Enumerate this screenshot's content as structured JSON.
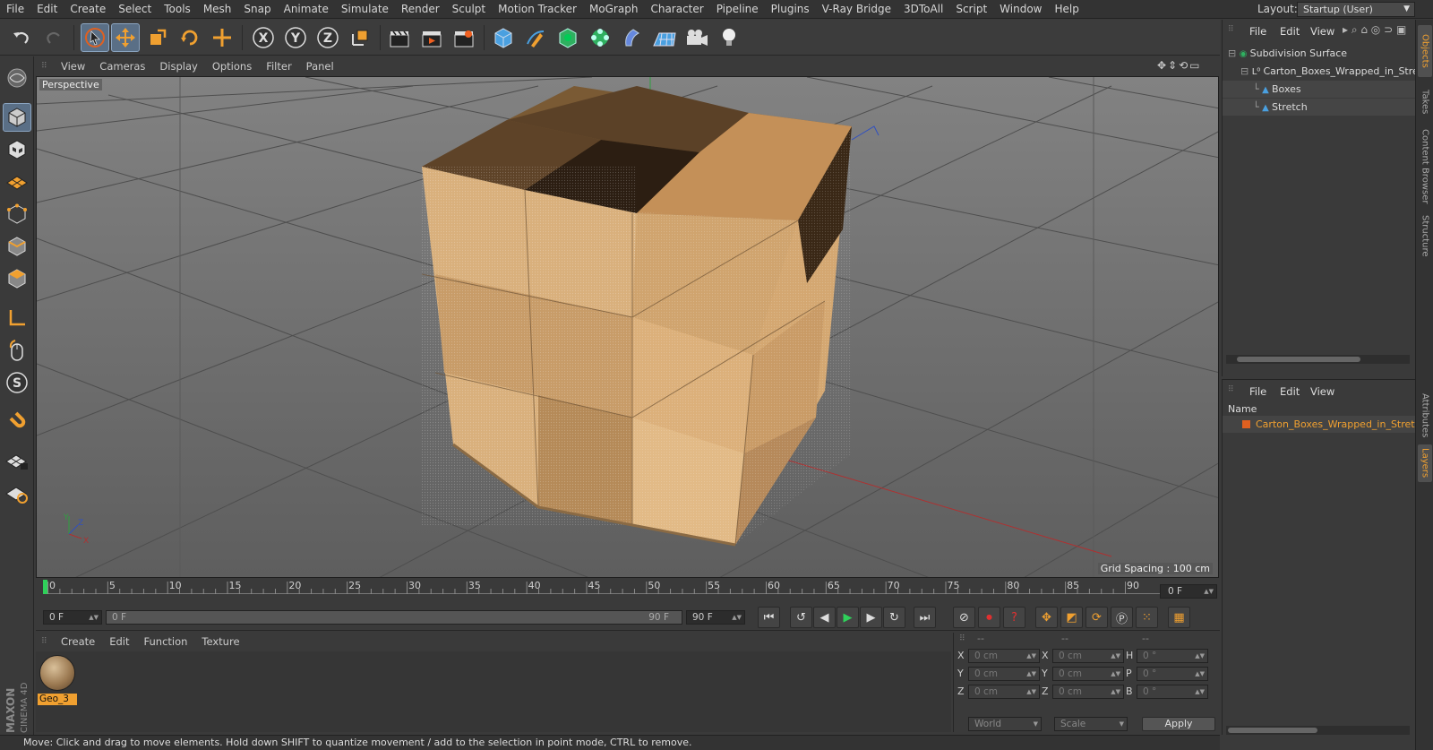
{
  "menubar": {
    "items": [
      "File",
      "Edit",
      "Create",
      "Select",
      "Tools",
      "Mesh",
      "Snap",
      "Animate",
      "Simulate",
      "Render",
      "Sculpt",
      "Motion Tracker",
      "MoGraph",
      "Character",
      "Pipeline",
      "Plugins",
      "V-Ray Bridge",
      "3DToAll",
      "Script",
      "Window",
      "Help"
    ],
    "layout_label": "Layout:",
    "layout_value": "Startup (User)"
  },
  "viewport": {
    "menus": [
      "View",
      "Cameras",
      "Display",
      "Options",
      "Filter",
      "Panel"
    ],
    "camera_label": "Perspective",
    "grid_spacing": "Grid Spacing : 100 cm",
    "axis_x": "X",
    "axis_y": "Y",
    "axis_z": "Z"
  },
  "timeline": {
    "ticks": [
      "0",
      "5",
      "10",
      "15",
      "20",
      "25",
      "30",
      "35",
      "40",
      "45",
      "50",
      "55",
      "60",
      "65",
      "70",
      "75",
      "80",
      "85",
      "90"
    ],
    "current_frame": "0 F"
  },
  "transport": {
    "start_field": "0 F",
    "range_start": "0 F",
    "range_end": "90 F",
    "end_field": "90 F"
  },
  "material_manager": {
    "menus": [
      "Create",
      "Edit",
      "Function",
      "Texture"
    ],
    "material_name": "Geo_3"
  },
  "coordinates": {
    "headers": [
      "--",
      "--",
      "--"
    ],
    "rows": [
      {
        "a": "X",
        "av": "0 cm",
        "b": "X",
        "bv": "0 cm",
        "c": "H",
        "cv": "0 °"
      },
      {
        "a": "Y",
        "av": "0 cm",
        "b": "Y",
        "bv": "0 cm",
        "c": "P",
        "cv": "0 °"
      },
      {
        "a": "Z",
        "av": "0 cm",
        "b": "Z",
        "bv": "0 cm",
        "c": "B",
        "cv": "0 °"
      }
    ],
    "mode_world": "World",
    "mode_scale": "Scale",
    "apply": "Apply"
  },
  "objects_panel": {
    "menus": [
      "File",
      "Edit",
      "View"
    ],
    "items": [
      {
        "label": "Subdivision Surface",
        "indent": 0
      },
      {
        "label": "Carton_Boxes_Wrapped_in_Stretch",
        "indent": 1
      },
      {
        "label": "Boxes",
        "indent": 2
      },
      {
        "label": "Stretch",
        "indent": 2
      }
    ]
  },
  "layers_panel": {
    "menus": [
      "File",
      "Edit",
      "View"
    ],
    "name_header": "Name",
    "layer": "Carton_Boxes_Wrapped_in_Stretch"
  },
  "right_tabs": [
    "Objects",
    "Takes",
    "Content Browser",
    "Structure",
    "Attributes",
    "Layers"
  ],
  "statusbar": {
    "text": "Move: Click and drag to move elements. Hold down SHIFT to quantize movement / add to the selection in point mode, CTRL to remove."
  },
  "logo": {
    "brand": "MAXON",
    "product": "CINEMA 4D"
  },
  "colors": {
    "accent": "#f0a030",
    "active": "#5a6f86",
    "cardboard": "#d9ae7a"
  }
}
